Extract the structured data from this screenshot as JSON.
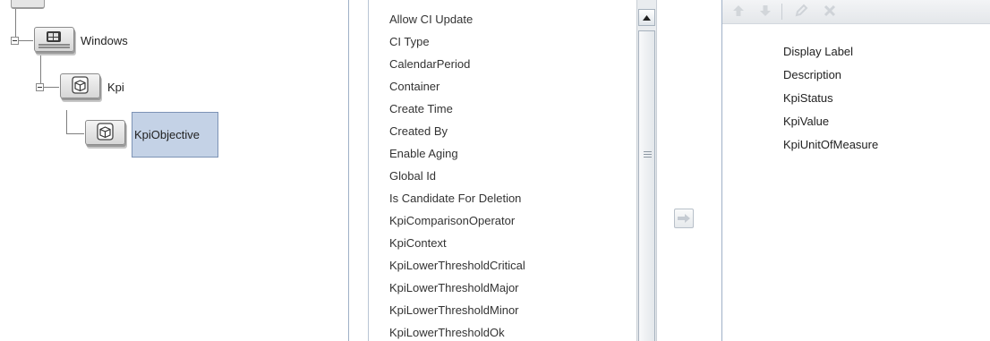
{
  "tree": {
    "nodes": [
      {
        "label": "Windows",
        "icon": "windows-ci-icon"
      },
      {
        "label": "Kpi",
        "icon": "cube-icon"
      },
      {
        "label": "KpiObjective",
        "icon": "cube-icon",
        "selected": true
      }
    ]
  },
  "available_attributes": [
    "Allow CI Update",
    "CI Type",
    "CalendarPeriod",
    "Container",
    "Create Time",
    "Created By",
    "Enable Aging",
    "Global Id",
    "Is Candidate For Deletion",
    "KpiComparisonOperator",
    "KpiContext",
    "KpiLowerThresholdCritical",
    "KpiLowerThresholdMajor",
    "KpiLowerThresholdMinor",
    "KpiLowerThresholdOk"
  ],
  "toolbar": {
    "icons": [
      "move-up-icon",
      "move-down-icon",
      "edit-icon",
      "delete-icon"
    ]
  },
  "selected_attributes": [
    "Display Label",
    "Description",
    "KpiStatus",
    "KpiValue",
    "KpiUnitOfMeasure"
  ],
  "move_button": {
    "icon": "arrow-right-icon"
  },
  "colors": {
    "selection": "#c4d2e6",
    "panel_border": "#9fb0c7",
    "disabled_icon": "#c8ccd1"
  }
}
